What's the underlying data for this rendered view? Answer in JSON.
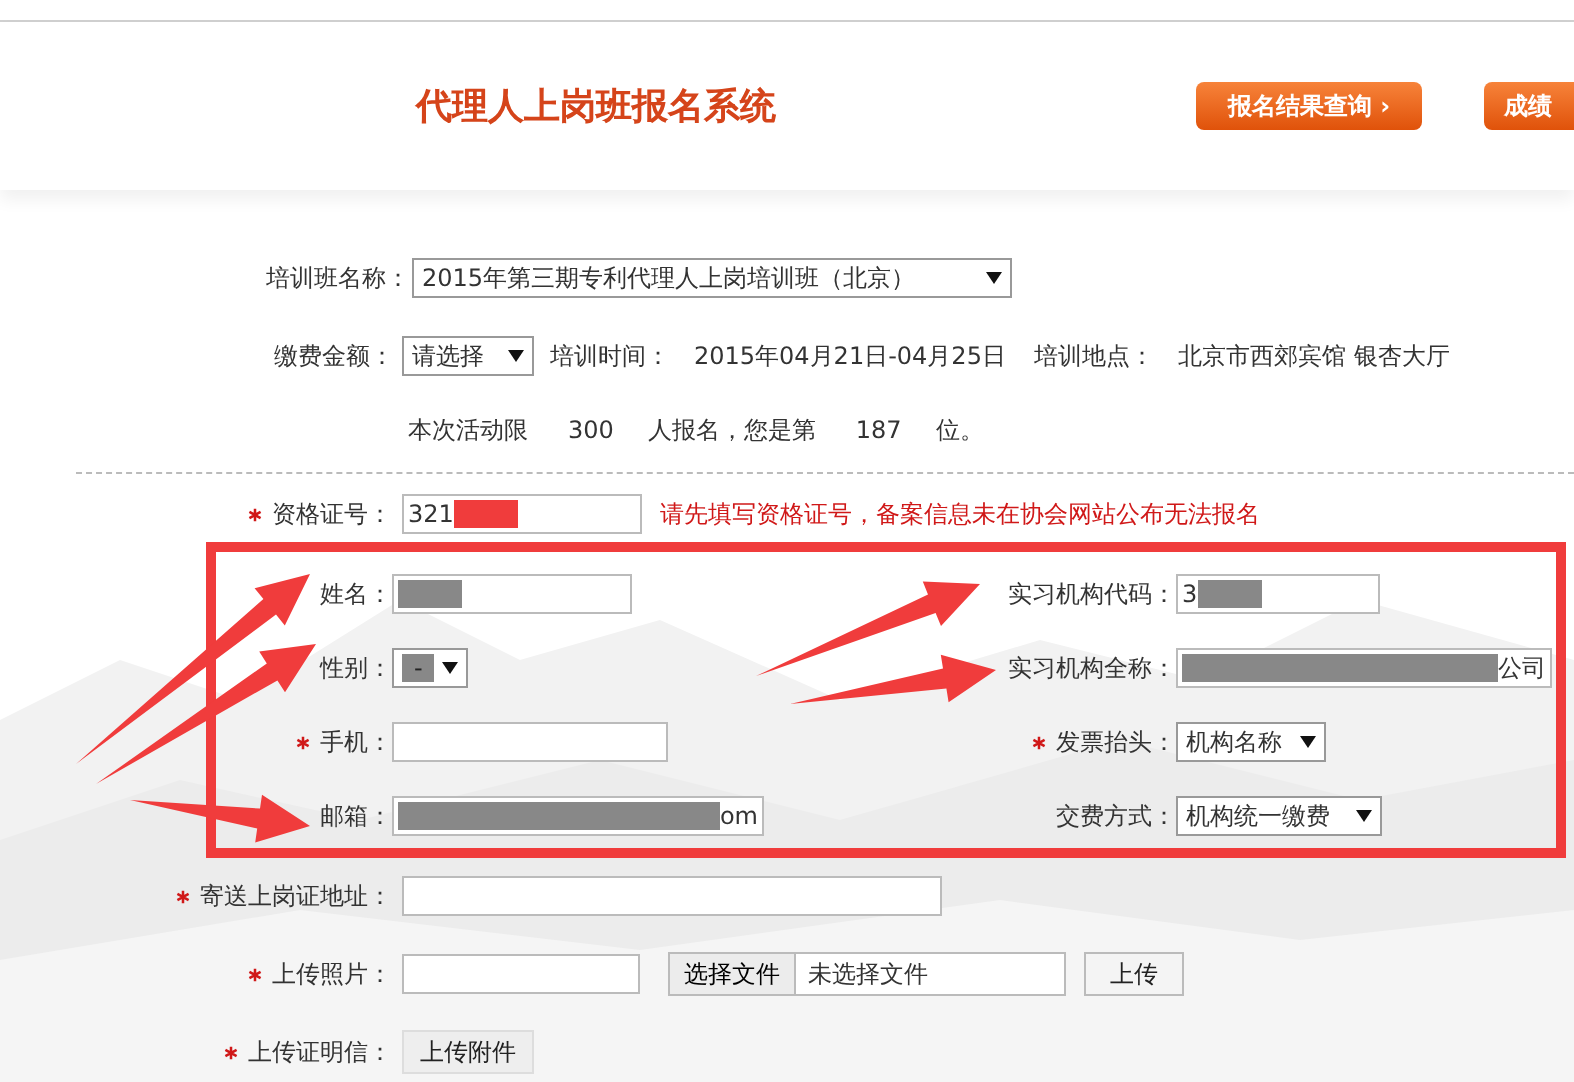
{
  "header": {
    "title": "代理人上岗班报名系统",
    "buttons": [
      {
        "label": "报名结果查询 ›"
      },
      {
        "label": "成绩"
      }
    ]
  },
  "course": {
    "label": "培训班名称：",
    "value": "2015年第三期专利代理人上岗培训班（北京）"
  },
  "fee": {
    "label": "缴费金额：",
    "value": "请选择"
  },
  "schedule": [
    {
      "kind": "label",
      "text": "培训时间："
    },
    {
      "kind": "value",
      "text": "2015年04月21日-04月25日"
    },
    {
      "kind": "label",
      "text": "培训地点："
    },
    {
      "kind": "value",
      "text": "北京市西郊宾馆 银杏大厅"
    }
  ],
  "quota": [
    "本次活动限",
    "300",
    "人报名，您是第",
    "187",
    "位。"
  ],
  "certificate": {
    "label": "资格证号：",
    "required": true,
    "value": [
      {
        "kind": "text",
        "text": "321"
      },
      {
        "kind": "redaction",
        "color": "#f03c3c"
      }
    ],
    "error": "请先填写资格证号，备案信息未在协会网站公布无法报名"
  },
  "highlighted": {
    "left": [
      {
        "label": "姓名：",
        "required": false,
        "kind": "input",
        "value": [
          {
            "kind": "redaction",
            "color": "#888888"
          }
        ]
      },
      {
        "label": "性别：",
        "required": false,
        "kind": "select",
        "value": [
          {
            "kind": "redaction",
            "color": "#888888",
            "text": "-"
          }
        ]
      },
      {
        "label": "手机：",
        "required": true,
        "kind": "input"
      },
      {
        "label": "邮箱：",
        "required": false,
        "kind": "input",
        "value": [
          {
            "kind": "redaction",
            "color": "#888888"
          },
          {
            "kind": "text",
            "text": "om"
          }
        ]
      }
    ],
    "right": [
      {
        "label": "实习机构代码：",
        "required": false,
        "kind": "input",
        "value": [
          {
            "kind": "text",
            "text": "3"
          },
          {
            "kind": "redaction",
            "color": "#888888"
          }
        ]
      },
      {
        "label": "实习机构全称：",
        "required": false,
        "kind": "input",
        "value": [
          {
            "kind": "redaction",
            "color": "#888888"
          },
          {
            "kind": "text",
            "text": "公司"
          }
        ]
      },
      {
        "label": "发票抬头：",
        "required": true,
        "kind": "select",
        "value": [
          {
            "kind": "text",
            "text": "机构名称"
          }
        ]
      },
      {
        "label": "交费方式：",
        "required": false,
        "kind": "select",
        "value": [
          {
            "kind": "text",
            "text": "机构统一缴费"
          }
        ]
      }
    ]
  },
  "address": {
    "label": "寄送上岗证地址：",
    "required": true
  },
  "photo": {
    "label": "上传照片：",
    "required": true,
    "file_button": "选择文件",
    "file_status": "未选择文件",
    "upload_button": "上传"
  },
  "letter": {
    "label": "上传证明信：",
    "required": true,
    "button": "上传附件"
  }
}
